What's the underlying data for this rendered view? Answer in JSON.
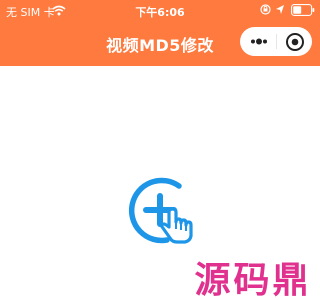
{
  "status_bar": {
    "carrier": "无 SIM 卡",
    "time": "下午6:06"
  },
  "nav": {
    "title": "视频MD5修改"
  },
  "capsule": {
    "more_icon": "more-dots-icon",
    "close_icon": "record-circle-icon"
  },
  "upload": {
    "icon": "add-circle-with-hand-icon"
  },
  "watermark": {
    "text": "源码鼎"
  },
  "colors": {
    "header": "#fe7a3e",
    "accent_blue": "#1e96e8",
    "watermark": "#e0318e"
  }
}
